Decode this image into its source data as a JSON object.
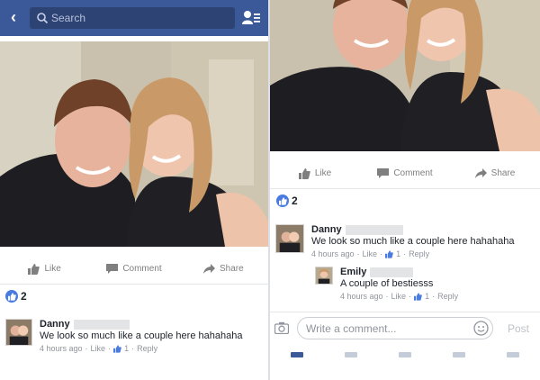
{
  "search": {
    "placeholder": "Search"
  },
  "actions": {
    "like": "Like",
    "comment": "Comment",
    "share": "Share"
  },
  "reactions": {
    "count": "2"
  },
  "comments": [
    {
      "name": "Danny",
      "text": "We look so much like a couple here hahahaha",
      "time": "4 hours ago",
      "like": "Like",
      "likes": "1",
      "reply": "Reply"
    },
    {
      "name": "Emily",
      "text": "A couple of bestiesss",
      "time": "4 hours ago",
      "like": "Like",
      "likes": "1",
      "reply": "Reply"
    }
  ],
  "composer": {
    "placeholder": "Write a comment...",
    "post_label": "Post"
  },
  "colors": {
    "brand": "#3b5998",
    "like_blue": "#4a7be0",
    "meta_gray": "#90949c"
  },
  "icons": [
    "back-arrow-icon",
    "search-icon",
    "friend-requests-icon",
    "like-icon",
    "comment-icon",
    "share-icon",
    "camera-icon",
    "emoji-icon"
  ]
}
